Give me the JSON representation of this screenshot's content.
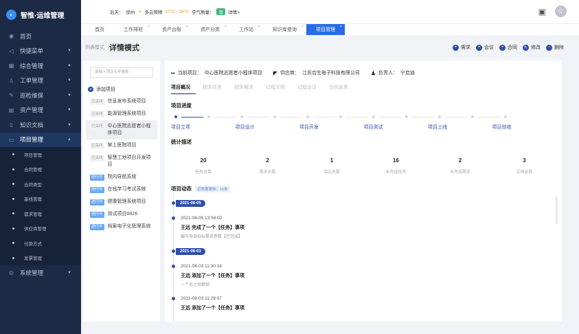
{
  "app": {
    "name": "智惟·运维管理",
    "logo_icon": "logo-icon"
  },
  "sidebar": {
    "items": [
      {
        "label": "首页",
        "icon": "home-icon",
        "glyph": "◉",
        "arrow": ""
      },
      {
        "label": "快捷菜单",
        "icon": "send-icon",
        "glyph": "◁",
        "arrow": "▼"
      },
      {
        "label": "综合管理",
        "icon": "grid-icon",
        "glyph": "▦",
        "arrow": "▼"
      },
      {
        "label": "工单管理",
        "icon": "person-icon",
        "glyph": "♙",
        "arrow": "▼"
      },
      {
        "label": "巡检维保",
        "icon": "tool-icon",
        "glyph": "✎",
        "arrow": "▼"
      },
      {
        "label": "资产管理",
        "icon": "box-icon",
        "glyph": "▤",
        "arrow": "▼"
      },
      {
        "label": "知识文档",
        "icon": "doc-icon",
        "glyph": "▯",
        "arrow": "▼"
      },
      {
        "label": "项目管理",
        "icon": "folder-icon",
        "glyph": "▭",
        "arrow": "▲"
      }
    ],
    "sub_items": [
      "项目管理",
      "合同管理",
      "合同类型",
      "基线管理",
      "需求管理",
      "供应商管理",
      "付款方式",
      "发票管理"
    ],
    "last_item": {
      "label": "系统管理",
      "icon": "settings-icon",
      "glyph": "◎",
      "arrow": "▼"
    }
  },
  "topbar": {
    "weather_label": "后天：",
    "city": "徐州",
    "weather": "多云转晴",
    "temp": "17°C~ 26°C",
    "aqi_label": "空气质量：",
    "aqi": "良",
    "detail": "详情>",
    "message_icon": "message-icon",
    "avatar_icon": "user-avatar-icon"
  },
  "tabs": [
    {
      "label": "首页",
      "closable": false,
      "active": false
    },
    {
      "label": "工作排班",
      "closable": true,
      "active": false
    },
    {
      "label": "资产台账",
      "closable": true,
      "active": false
    },
    {
      "label": "资产分类",
      "closable": true,
      "active": false
    },
    {
      "label": "工作站",
      "closable": true,
      "active": false
    },
    {
      "label": "知识库查询",
      "closable": true,
      "active": false
    },
    {
      "label": "项目管理",
      "closable": true,
      "active": true
    }
  ],
  "page": {
    "breadcrumb": "列表模式",
    "title": "详情模式",
    "actions": [
      {
        "label": "需求",
        "icon": "plus-circle-icon",
        "glyph": "+"
      },
      {
        "label": "会议",
        "icon": "plus-circle-icon",
        "glyph": "+"
      },
      {
        "label": "合同",
        "icon": "plus-circle-icon",
        "glyph": "+"
      },
      {
        "label": "修改",
        "icon": "edit-icon",
        "glyph": "✎"
      },
      {
        "label": "删除",
        "icon": "delete-icon",
        "glyph": "−"
      }
    ]
  },
  "projects": {
    "search_placeholder": "请输入项目名称搜索",
    "add_label": "添加项目",
    "items": [
      {
        "status": "已关闭",
        "status_type": "closed",
        "name": "信息发布系统项目",
        "selected": false
      },
      {
        "status": "已关闭",
        "status_type": "closed",
        "name": "能源管理系统项目",
        "selected": false
      },
      {
        "status": "已关闭",
        "status_type": "closed",
        "name": "中心医院志愿者小程序项目",
        "selected": true
      },
      {
        "status": "已关闭",
        "status_type": "closed",
        "name": "掌上医院项目",
        "selected": false
      },
      {
        "status": "已关闭",
        "status_type": "closed",
        "name": "智慧工地项目开发项目",
        "selected": false
      },
      {
        "status": "进行中",
        "status_type": "progress",
        "name": "院内导航系统",
        "selected": false
      },
      {
        "status": "进行中",
        "status_type": "progress",
        "name": "在线学习考试系统",
        "selected": false
      },
      {
        "status": "进行中",
        "status_type": "progress",
        "name": "健康管理系统项目",
        "selected": false
      },
      {
        "status": "进行中",
        "status_type": "progress",
        "name": "测试项目0826",
        "selected": false
      },
      {
        "status": "进行中",
        "status_type": "progress",
        "name": "档案电子化管理系统",
        "selected": false
      }
    ]
  },
  "detail": {
    "current_project_label": "当前项目：",
    "current_project": "中心医院志愿者小程序项目",
    "supplier_label": "供应商：",
    "supplier": "江苏合生电子科技有限公司",
    "owner_label": "负责人：",
    "owner": "宁启迪",
    "subtabs": [
      "项目概况",
      "相关任务",
      "相关需求",
      "过程文档",
      "过程会议",
      "合同发票"
    ],
    "progress_title": "项目进度",
    "progress_steps": [
      "项目立项",
      "项目设计",
      "项目开发",
      "项目测试",
      "项目上线",
      "项目验收"
    ],
    "progress_done_fraction": 0.18,
    "stats_title": "统计描述",
    "stats": [
      {
        "value": "20",
        "label": "任务总数"
      },
      {
        "value": "2",
        "label": "需求总数"
      },
      {
        "value": "1",
        "label": "会议总数"
      },
      {
        "value": "16",
        "label": "未完成任务"
      },
      {
        "value": "2",
        "label": "未完成需求"
      },
      {
        "value": "3",
        "label": "文档总数"
      }
    ],
    "dynamics_title": "项目动态",
    "dynamics_tip": "近两周更新：16条",
    "timeline": [
      {
        "date": "2021-08-05",
        "time": "2021-08-05 13:59:02",
        "title": "王远 完成了一个【任务】事项",
        "desc": "编写项目招标需求参数【已完成】"
      },
      {
        "date": "2021-08-03",
        "time": "2021-08-03 11:30:14",
        "title": "王远 添加了一个【任务】事项",
        "desc": "一个月之后解锁"
      },
      {
        "date": "",
        "time": "2021-08-03 11:29:07",
        "title": "王远 添加了一个【任务】事项",
        "desc": ""
      }
    ]
  }
}
